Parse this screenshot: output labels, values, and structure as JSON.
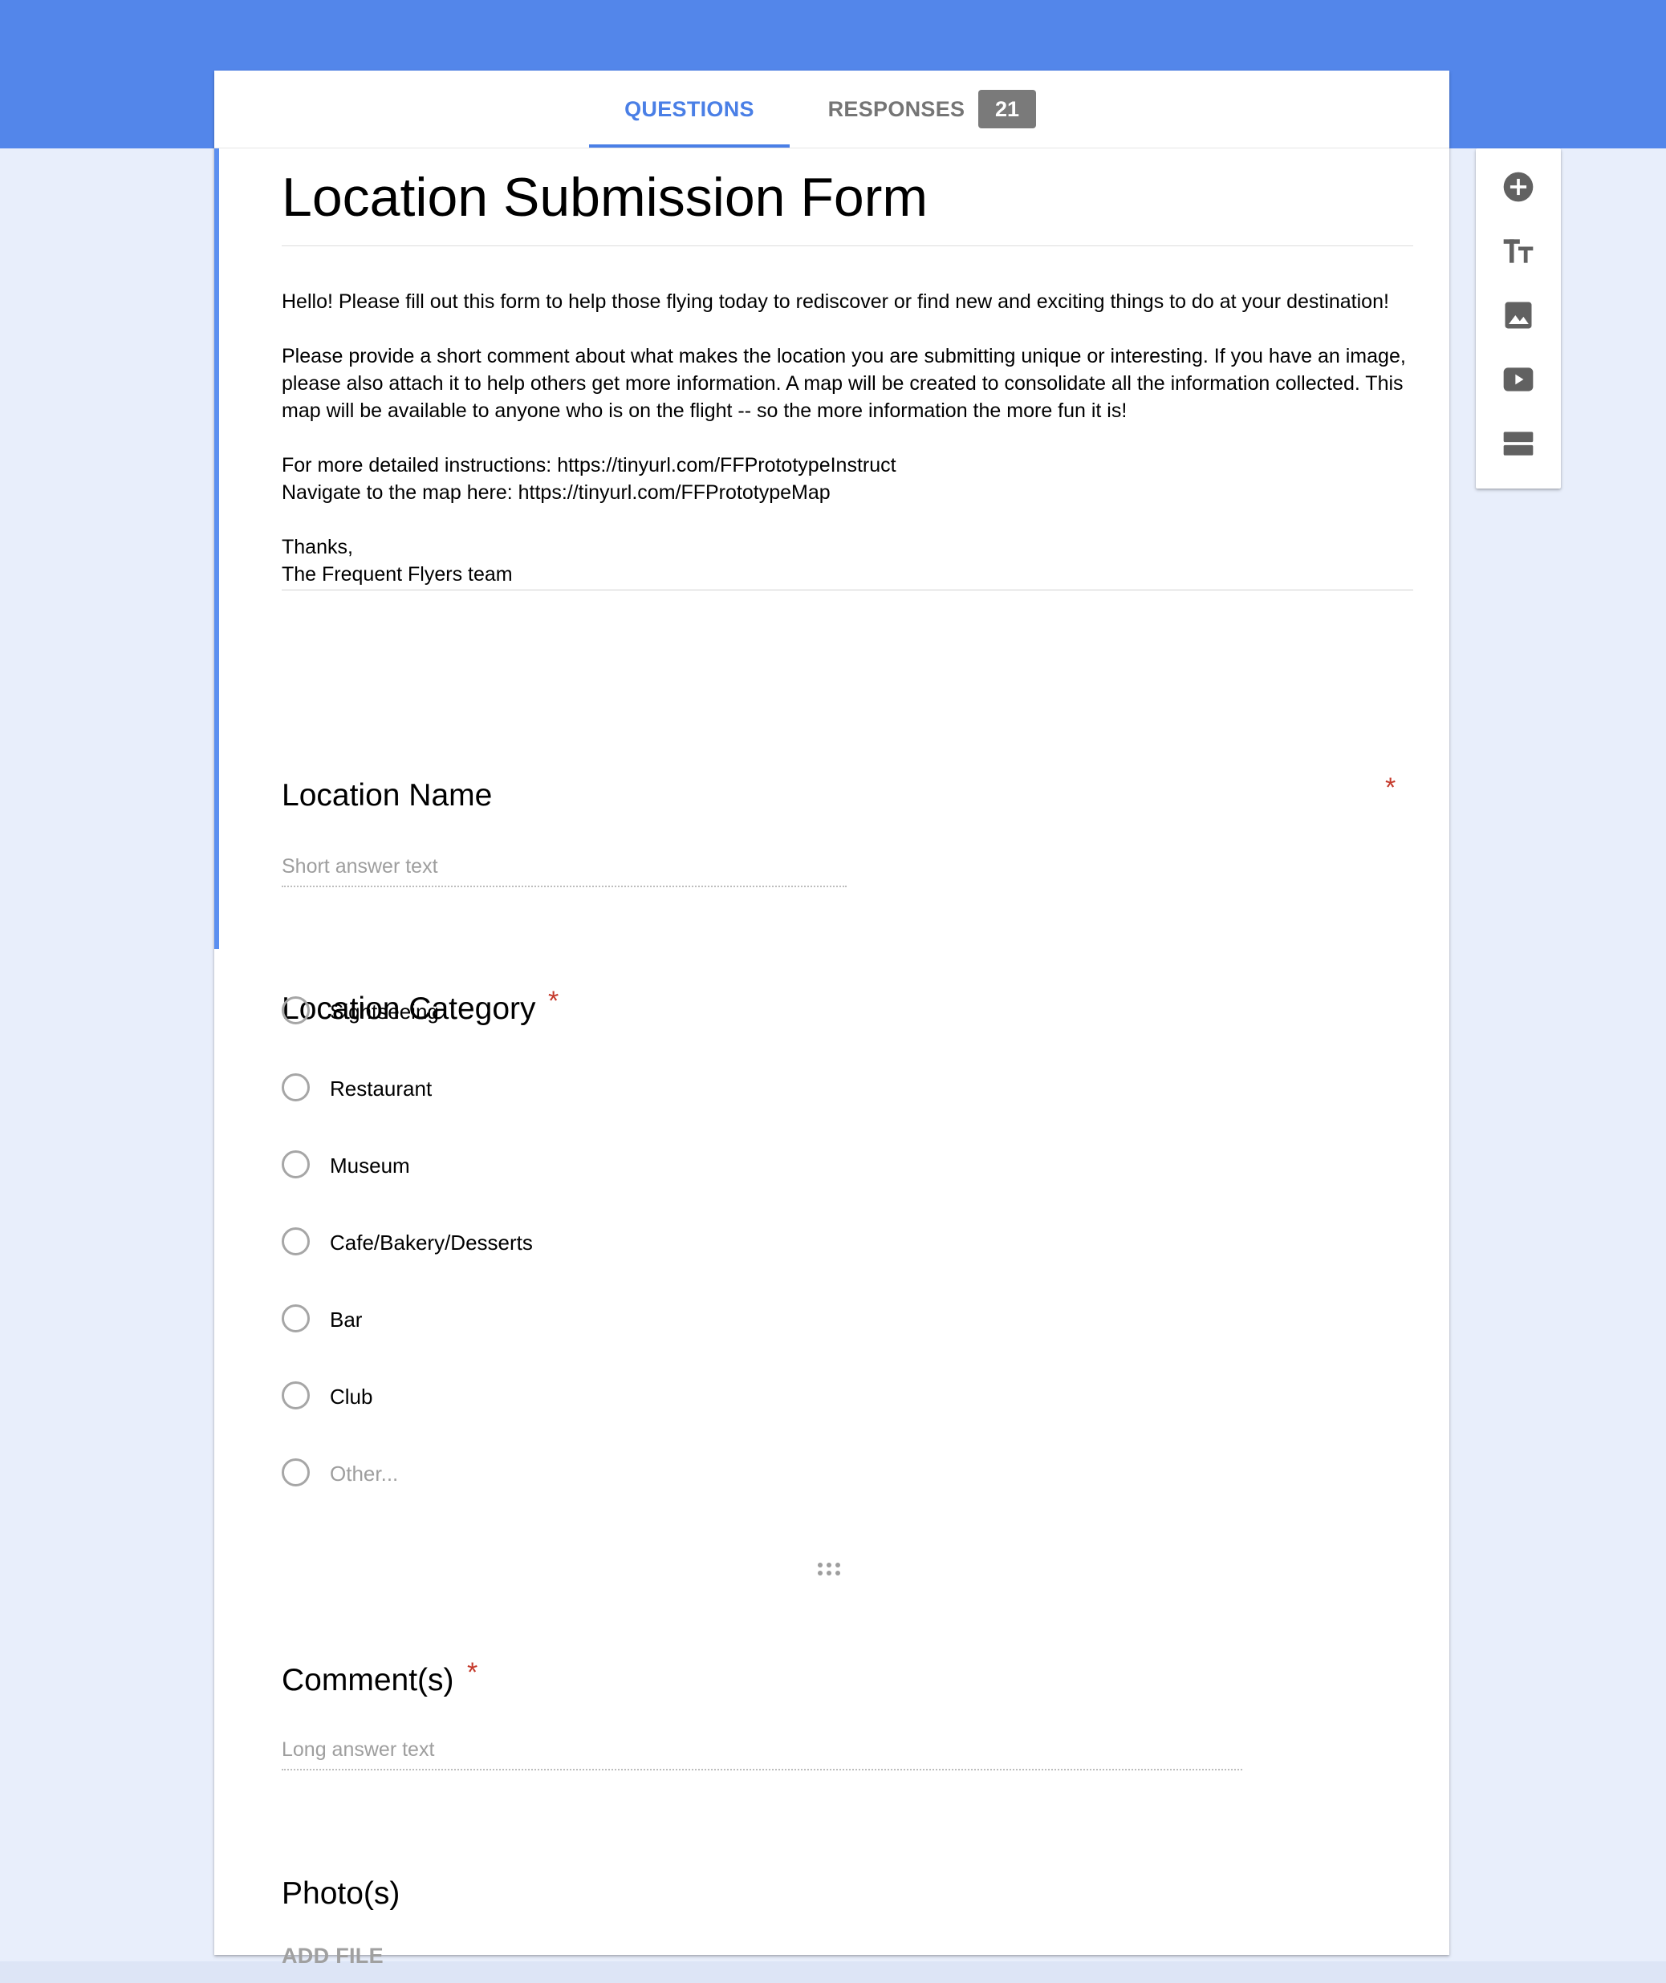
{
  "tabs": {
    "questions_label": "QUESTIONS",
    "responses_label": "RESPONSES",
    "responses_count": "21"
  },
  "form": {
    "title": "Location Submission Form",
    "description": {
      "p1": "Hello! Please fill out this form to help those flying today to rediscover or find new and exciting things to do at your destination!",
      "p2": "Please provide a short comment about what makes the location you are submitting unique or interesting. If you have an image, please also attach it to help others get more information. A map will be created to consolidate all the information collected. This map will be available to anyone who is on the flight -- so the more information the more fun it is!",
      "p3": "For more detailed instructions: https://tinyurl.com/FFPrototypeInstruct\nNavigate to the map here: https://tinyurl.com/FFPrototypeMap",
      "p4": "Thanks,\nThe Frequent Flyers team"
    }
  },
  "questions": {
    "location_name": {
      "title": "Location Name",
      "required_mark": "*",
      "placeholder": "Short answer text"
    },
    "location_category": {
      "title": "Location Category",
      "required_mark": "*",
      "options": [
        "Sightseeing",
        "Restaurant",
        "Museum",
        "Cafe/Bakery/Desserts",
        "Bar",
        "Club",
        "Other..."
      ]
    },
    "comments": {
      "title": "Comment(s)",
      "required_mark": "*",
      "placeholder": "Long answer text"
    },
    "photos": {
      "title": "Photo(s)",
      "add_file_label": "ADD FILE"
    }
  },
  "toolbar": {
    "items": [
      "add-question-icon",
      "title-text-icon",
      "image-icon",
      "video-icon",
      "section-icon"
    ]
  },
  "colors": {
    "header_blue": "#5386ea",
    "accent_blue": "#4a7fe6",
    "required_red": "#c5392b",
    "background": "#e8eefb"
  }
}
